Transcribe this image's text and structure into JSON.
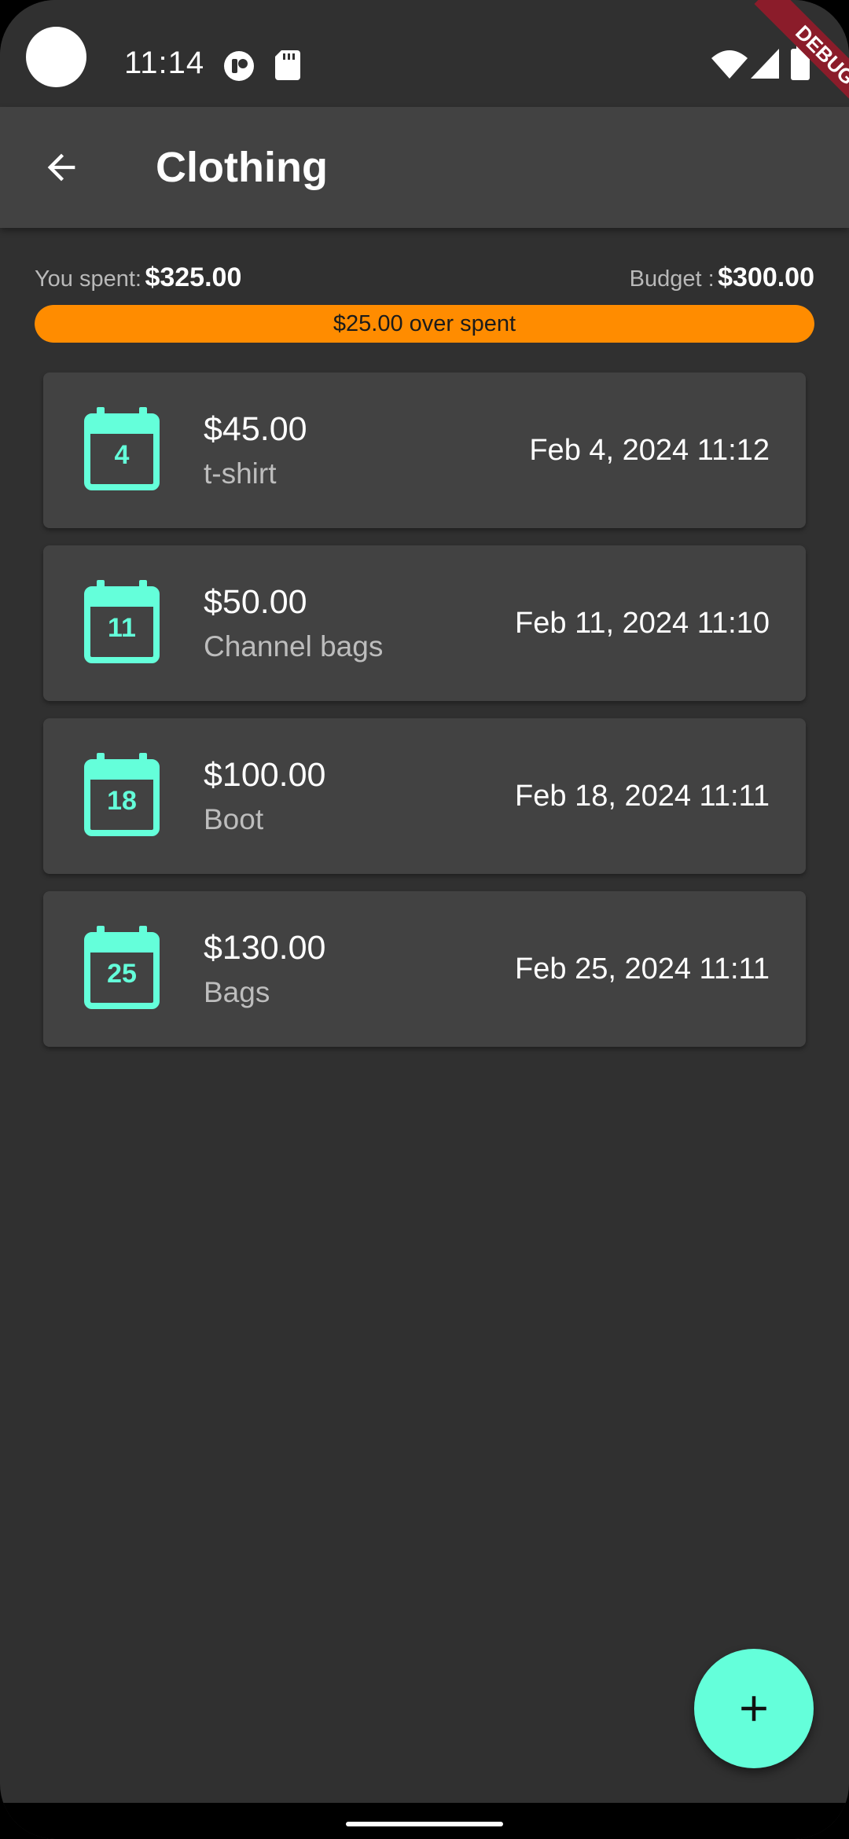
{
  "status_bar": {
    "time": "11:14",
    "icons": [
      "app-notification-icon",
      "sd-card-icon",
      "wifi-icon",
      "signal-icon",
      "battery-icon"
    ],
    "debug_label": "DEBUG"
  },
  "app_bar": {
    "back_icon": "arrow-back-icon",
    "title": "Clothing"
  },
  "summary": {
    "spent_label": "You spent:",
    "spent_value": "$325.00",
    "budget_label": "Budget :",
    "budget_value": "$300.00",
    "progress_text": "$25.00  over spent",
    "progress_fraction": 1.0,
    "progress_color": "#ff8c00"
  },
  "expenses": [
    {
      "day": "4",
      "amount": "$45.00",
      "description": "t-shirt",
      "datetime": "Feb 4, 2024 11:12"
    },
    {
      "day": "11",
      "amount": "$50.00",
      "description": "Channel bags",
      "datetime": "Feb 11, 2024 11:10"
    },
    {
      "day": "18",
      "amount": "$100.00",
      "description": "Boot",
      "datetime": "Feb 18, 2024 11:11"
    },
    {
      "day": "25",
      "amount": "$130.00",
      "description": "Bags",
      "datetime": "Feb 25, 2024 11:11"
    }
  ],
  "fab": {
    "icon": "plus-icon"
  },
  "colors": {
    "accent": "#64ffda",
    "background": "#303030",
    "surface": "#424242",
    "warning": "#ff8c00"
  }
}
